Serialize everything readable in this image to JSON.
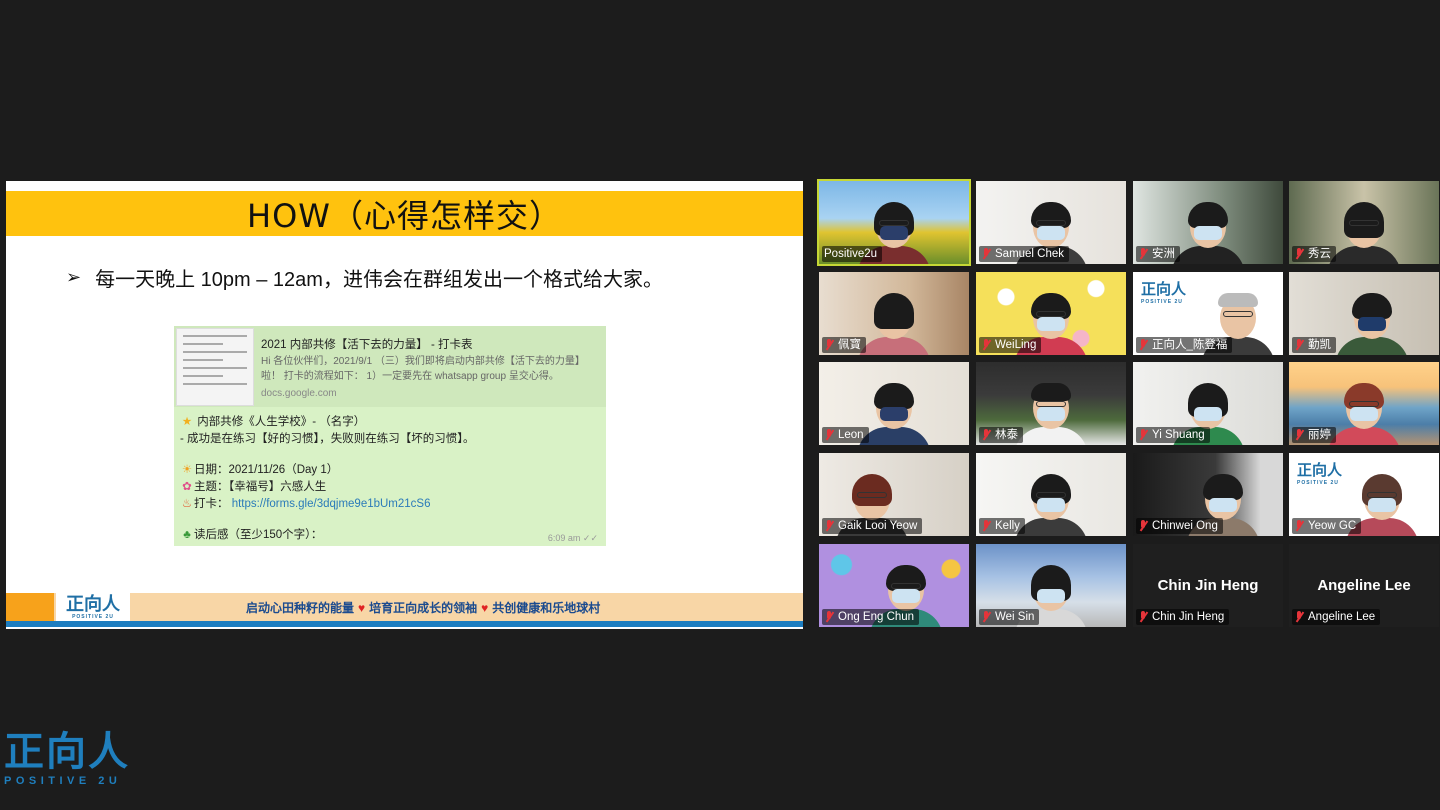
{
  "slide": {
    "title": "HOW（心得怎样交）",
    "bullet": "每一天晚上 10pm – 12am，进伟会在群组发出一个格式给大家。",
    "chat": {
      "link_title": "2021 内部共修【活下去的力量】 - 打卡表",
      "link_desc": "Hi 各位伙伴们，2021/9/1 （三）我们即将启动内部共修【活下去的力量】啦！ 打卡的流程如下： 1）一定要先在 whatsapp group 呈交心得。",
      "link_domain": "docs.google.com",
      "line1": "内部共修《人生学校》- （名字）",
      "line2": "- 成功是在练习【好的习惯】，失败则在练习【坏的习惯】。",
      "date": "日期：2021/11/26（Day 1）",
      "topic": "主题：【幸福号】六感人生",
      "checkin_label": "打卡：",
      "checkin_url": "https://forms.gle/3dqjme9e1bUm21cS6",
      "reflection": "读后感（至少150个字）：",
      "time": "6:09 am ✓✓"
    },
    "footer": {
      "logo_cn": "正向人",
      "logo_en": "POSITIVE 2U",
      "slogan1": "启动心田种籽的能量",
      "slogan2": "培育正向成长的领袖",
      "slogan3": "共创健康和乐地球村"
    }
  },
  "participants": [
    {
      "name": "Positive2u",
      "muted": false,
      "active": true
    },
    {
      "name": "Samuel Chek",
      "muted": true
    },
    {
      "name": "安洲",
      "muted": true
    },
    {
      "name": "秀云",
      "muted": true
    },
    {
      "name": "佩寶",
      "muted": true
    },
    {
      "name": "WeiLing",
      "muted": true
    },
    {
      "name": "正向人_陈登福",
      "muted": true
    },
    {
      "name": "勤凯",
      "muted": true
    },
    {
      "name": "Leon",
      "muted": true
    },
    {
      "name": "林泰",
      "muted": true
    },
    {
      "name": "Yi Shuang",
      "muted": true
    },
    {
      "name": "丽婷",
      "muted": true
    },
    {
      "name": "Gaik Looi Yeow",
      "muted": true
    },
    {
      "name": "Kelly",
      "muted": true
    },
    {
      "name": "Chinwei Ong",
      "muted": true
    },
    {
      "name": "Yeow GC",
      "muted": true
    },
    {
      "name": "Ong Eng Chun",
      "muted": true
    },
    {
      "name": "Wei Sin",
      "muted": true
    },
    {
      "name": "Chin Jin Heng",
      "muted": true,
      "video_off": true
    },
    {
      "name": "Angeline Lee",
      "muted": true,
      "video_off": true
    }
  ],
  "tile_logo": {
    "cn": "正向人",
    "en": "POSITIVE 2U"
  },
  "corner_logo": {
    "cn": "正向人",
    "en": "POSITIVE 2U"
  },
  "colors": {
    "accent": "#c6d735",
    "slide_title_bar": "#ffc20e",
    "brand_blue": "#1f7fbe",
    "muted_red": "#e5343a"
  }
}
